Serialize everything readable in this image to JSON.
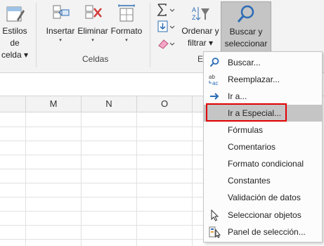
{
  "ribbon": {
    "styles_button": {
      "line1": "Estilos de",
      "line2": "celda"
    },
    "insert_label": "Insertar",
    "delete_label": "Eliminar",
    "format_label": "Formato",
    "cells_group_label": "Celdas",
    "sort_button": {
      "line1": "Ordenar y",
      "line2": "filtrar"
    },
    "edit_group_label_partial": "E",
    "find_button": {
      "line1": "Buscar y",
      "line2": "seleccionar"
    },
    "dropdown_glyph": "▾",
    "accent_color": "#2b6cb5"
  },
  "columns": [
    "M",
    "N",
    "O"
  ],
  "menu": {
    "items": [
      {
        "label": "Buscar...",
        "icon": "search-icon"
      },
      {
        "label": "Reemplazar...",
        "icon": "replace-icon"
      },
      {
        "label": "Ir a...",
        "icon": "arrow-right-icon"
      },
      {
        "label": "Ir a Especial...",
        "icon": "none",
        "highlighted": true
      },
      {
        "label": "Fórmulas",
        "icon": "none"
      },
      {
        "label": "Comentarios",
        "icon": "none"
      },
      {
        "label": "Formato condicional",
        "icon": "none"
      },
      {
        "label": "Constantes",
        "icon": "none"
      },
      {
        "label": "Validación de datos",
        "icon": "none"
      },
      {
        "label": "Seleccionar objetos",
        "icon": "cursor-icon"
      },
      {
        "label": "Panel de selección...",
        "icon": "selection-pane-icon"
      }
    ]
  }
}
